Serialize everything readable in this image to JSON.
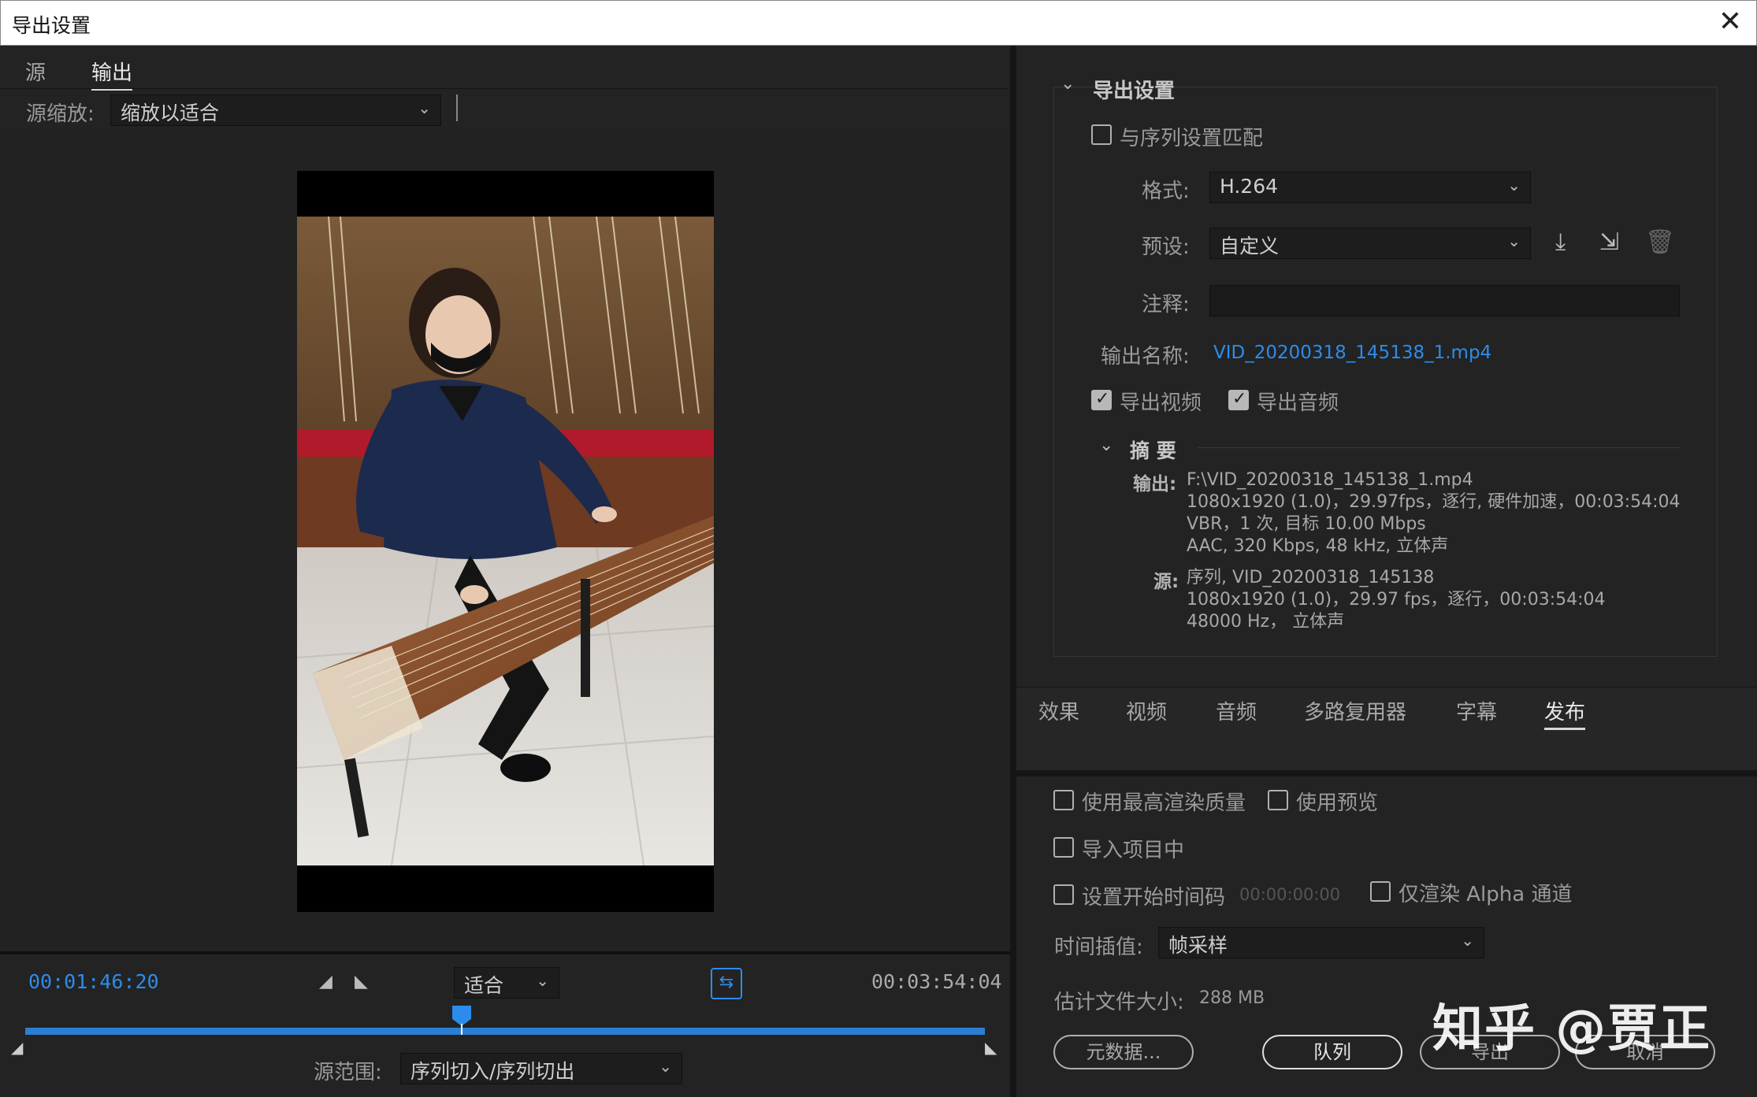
{
  "window": {
    "title": "导出设置",
    "close_glyph": "✕"
  },
  "left": {
    "tabs": [
      {
        "label": "源"
      },
      {
        "label": "输出"
      }
    ],
    "source_scale": {
      "label": "源缩放:",
      "value": "缩放以适合"
    },
    "timeline": {
      "current_time": "00:01:46:20",
      "duration": "00:03:54:04",
      "fit": "适合",
      "progress": 0.458,
      "range_label": "源范围:",
      "range_value": "序列切入/序列切出"
    }
  },
  "right": {
    "section_title": "导出设置",
    "match_sequence": {
      "label": "与序列设置匹配",
      "checked": false
    },
    "format": {
      "label": "格式:",
      "value": "H.264"
    },
    "preset": {
      "label": "预设:",
      "value": "自定义"
    },
    "comment": {
      "label": "注释:",
      "value": ""
    },
    "output_name": {
      "label": "输出名称:",
      "value": "VID_20200318_145138_1.mp4"
    },
    "export_video": {
      "label": "导出视频",
      "checked": true
    },
    "export_audio": {
      "label": "导出音频",
      "checked": true
    },
    "summary": {
      "title": "摘 要",
      "output_key": "输出:",
      "output_lines": [
        "F:\\VID_20200318_145138_1.mp4",
        "1080x1920 (1.0)，29.97fps，逐行, 硬件加速，00:03:54:04",
        "VBR，1 次, 目标 10.00 Mbps",
        "AAC, 320 Kbps, 48 kHz, 立体声"
      ],
      "source_key": "源:",
      "source_lines": [
        "序列, VID_20200318_145138",
        "1080x1920 (1.0)，29.97 fps，逐行，00:03:54:04",
        "48000 Hz， 立体声"
      ]
    },
    "tabs": [
      {
        "label": "效果"
      },
      {
        "label": "视频"
      },
      {
        "label": "音频"
      },
      {
        "label": "多路复用器"
      },
      {
        "label": "字幕"
      },
      {
        "label": "发布"
      }
    ],
    "options": {
      "max_quality": {
        "label": "使用最高渲染质量",
        "checked": false
      },
      "use_preview": {
        "label": "使用预览",
        "checked": false
      },
      "import_project": {
        "label": "导入项目中",
        "checked": false
      },
      "start_timecode": {
        "label": "设置开始时间码",
        "checked": false,
        "value": "00:00:00:00"
      },
      "alpha_only": {
        "label": "仅渲染 Alpha 通道",
        "checked": false
      },
      "interp": {
        "label": "时间插值:",
        "value": "帧采样"
      },
      "file_size": {
        "label": "估计文件大小:",
        "value": "288 MB"
      }
    },
    "buttons": {
      "metadata": "元数据...",
      "queue": "队列",
      "export": "导出",
      "cancel": "取消"
    }
  },
  "watermark": "知乎 @贾正",
  "colors": {
    "accent": "#2d8ceb",
    "panel": "#232323",
    "titlebar": "#ffffff"
  }
}
